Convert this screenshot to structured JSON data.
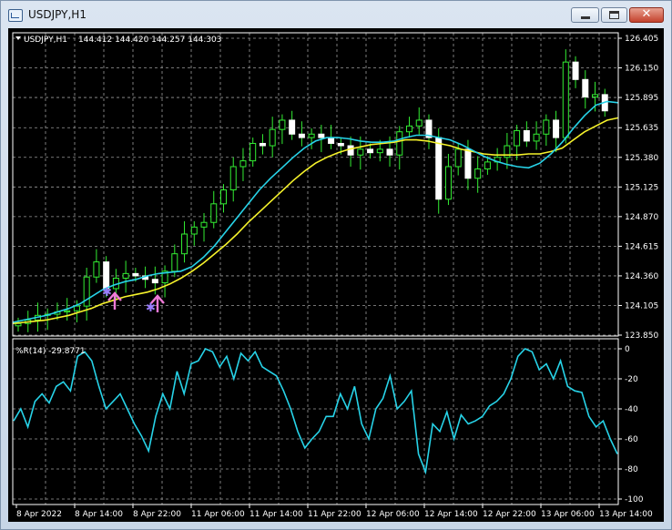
{
  "window": {
    "title": "USDJPY,H1",
    "buttons": {
      "minimize": "minimize",
      "maximize": "maximize",
      "close": "✕"
    }
  },
  "chart_data": [
    {
      "type": "candlestick",
      "title": "USDJPY,H1  144.412 144.420 144.257 144.303",
      "symbol": "USDJPY,H1",
      "ohlc_header": "144.412 144.420 144.257 144.303",
      "y_ticks": [
        "126.405",
        "126.150",
        "125.895",
        "125.635",
        "125.380",
        "125.125",
        "124.870",
        "124.615",
        "124.360",
        "124.105",
        "123.850"
      ],
      "ylim": [
        123.85,
        126.405
      ],
      "x_ticks": [
        "8 Apr 2022",
        "8 Apr 14:00",
        "8 Apr 22:00",
        "11 Apr 06:00",
        "11 Apr 14:00",
        "11 Apr 22:00",
        "12 Apr 06:00",
        "12 Apr 14:00",
        "12 Apr 22:00",
        "13 Apr 06:00",
        "13 Apr 14:00"
      ],
      "series": [
        {
          "name": "fast MA",
          "color": "#27d3e8",
          "values": [
            123.96,
            123.98,
            124.0,
            124.02,
            124.05,
            124.08,
            124.12,
            124.18,
            124.24,
            124.28,
            124.31,
            124.33,
            124.36,
            124.38,
            124.39,
            124.4,
            124.44,
            124.52,
            124.62,
            124.74,
            124.86,
            124.98,
            125.1,
            125.2,
            125.29,
            125.38,
            125.46,
            125.52,
            125.55,
            125.55,
            125.54,
            125.52,
            125.51,
            125.51,
            125.52,
            125.55,
            125.57,
            125.57,
            125.55,
            125.53,
            125.49,
            125.44,
            125.39,
            125.35,
            125.32,
            125.3,
            125.29,
            125.33,
            125.41,
            125.51,
            125.63,
            125.74,
            125.83,
            125.86,
            125.85
          ]
        },
        {
          "name": "slow MA",
          "color": "#f6f32b",
          "values": [
            123.95,
            123.96,
            123.97,
            123.98,
            124.0,
            124.02,
            124.05,
            124.08,
            124.12,
            124.15,
            124.18,
            124.2,
            124.22,
            124.25,
            124.29,
            124.34,
            124.4,
            124.47,
            124.55,
            124.63,
            124.72,
            124.82,
            124.91,
            125.0,
            125.09,
            125.18,
            125.26,
            125.33,
            125.38,
            125.42,
            125.45,
            125.47,
            125.49,
            125.5,
            125.51,
            125.53,
            125.53,
            125.52,
            125.5,
            125.48,
            125.45,
            125.43,
            125.41,
            125.4,
            125.4,
            125.4,
            125.41,
            125.41,
            125.43,
            125.46,
            125.53,
            125.6,
            125.65,
            125.7,
            125.72
          ]
        },
        {
          "name": "candles_close",
          "values": [
            123.95,
            123.98,
            124.02,
            124.03,
            124.05,
            124.06,
            124.1,
            124.35,
            124.48,
            124.25,
            124.34,
            124.38,
            124.36,
            124.33,
            124.3,
            124.4,
            124.55,
            124.72,
            124.78,
            124.82,
            124.98,
            125.1,
            125.3,
            125.35,
            125.5,
            125.48,
            125.62,
            125.7,
            125.58,
            125.55,
            125.58,
            125.55,
            125.5,
            125.48,
            125.4,
            125.45,
            125.42,
            125.45,
            125.4,
            125.6,
            125.65,
            125.7,
            125.55,
            125.02,
            125.3,
            125.45,
            125.2,
            125.28,
            125.34,
            125.38,
            125.48,
            125.61,
            125.52,
            125.58,
            125.7,
            125.55,
            126.2,
            126.05,
            125.9,
            125.92,
            125.78
          ]
        }
      ],
      "markers": [
        "up-arrow",
        "up-arrow"
      ]
    },
    {
      "type": "line",
      "title": "%R(14) -29.8771",
      "indicator_label": "%R(14) -29.8771",
      "y_ticks": [
        "0",
        "-20",
        "-40",
        "-60",
        "-80",
        "-100"
      ],
      "ylim": [
        -100,
        0
      ],
      "series": [
        {
          "name": "%R(14)",
          "color": "#27d3e8",
          "values": [
            -48,
            -40,
            -52,
            -35,
            -30,
            -36,
            -25,
            -22,
            -28,
            -5,
            -2,
            -8,
            -25,
            -40,
            -35,
            -30,
            -40,
            -50,
            -58,
            -68,
            -45,
            -30,
            -40,
            -15,
            -30,
            -10,
            -8,
            0,
            -2,
            -12,
            -5,
            -20,
            -3,
            -8,
            -2,
            -12,
            -15,
            -18,
            -28,
            -40,
            -55,
            -66,
            -60,
            -55,
            -45,
            -45,
            -30,
            -40,
            -25,
            -50,
            -60,
            -40,
            -33,
            -18,
            -40,
            -35,
            -28,
            -70,
            -82,
            -50,
            -55,
            -42,
            -60,
            -44,
            -50,
            -48,
            -45,
            -38,
            -35,
            -30,
            -20,
            -5,
            0,
            -2,
            -14,
            -10,
            -20,
            -8,
            -25,
            -28,
            -29,
            -45,
            -52,
            -48,
            -60,
            -70
          ]
        }
      ]
    }
  ]
}
